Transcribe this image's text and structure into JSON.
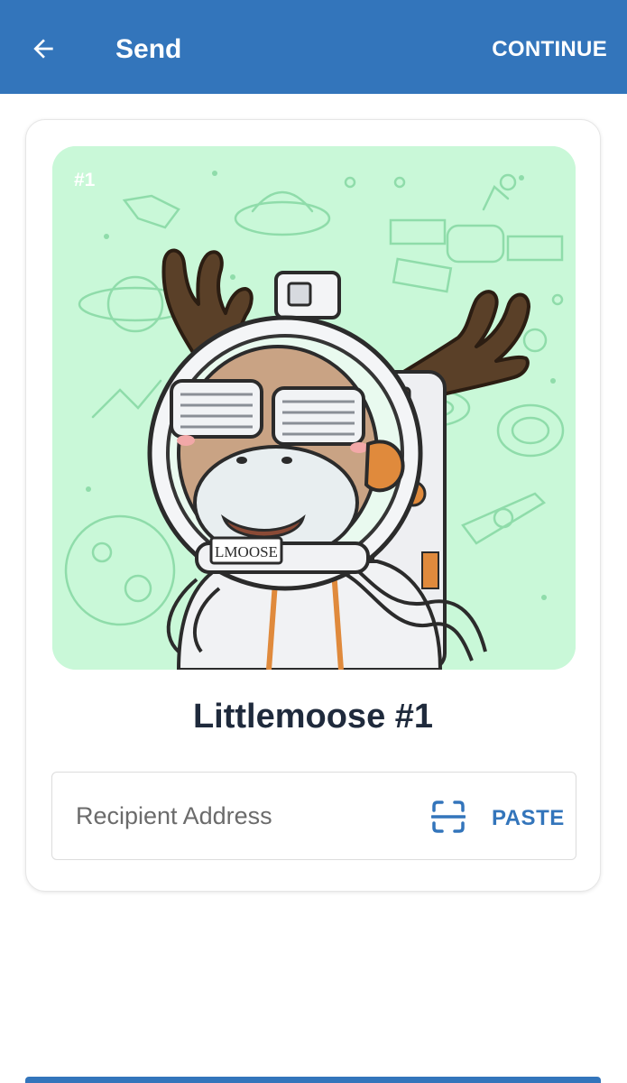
{
  "header": {
    "title": "Send",
    "continue_label": "CONTINUE",
    "background_color": "#3375bb"
  },
  "nft": {
    "badge": "#1",
    "name": "Littlemoose #1",
    "name_tag": "LMOOSE",
    "background_color": "#c9f8d8"
  },
  "recipient": {
    "placeholder": "Recipient Address",
    "value": "",
    "scan_icon": "scan-qr-icon",
    "paste_label": "PASTE"
  },
  "colors": {
    "accent": "#3375bb",
    "title_text": "#1f2a3c"
  }
}
